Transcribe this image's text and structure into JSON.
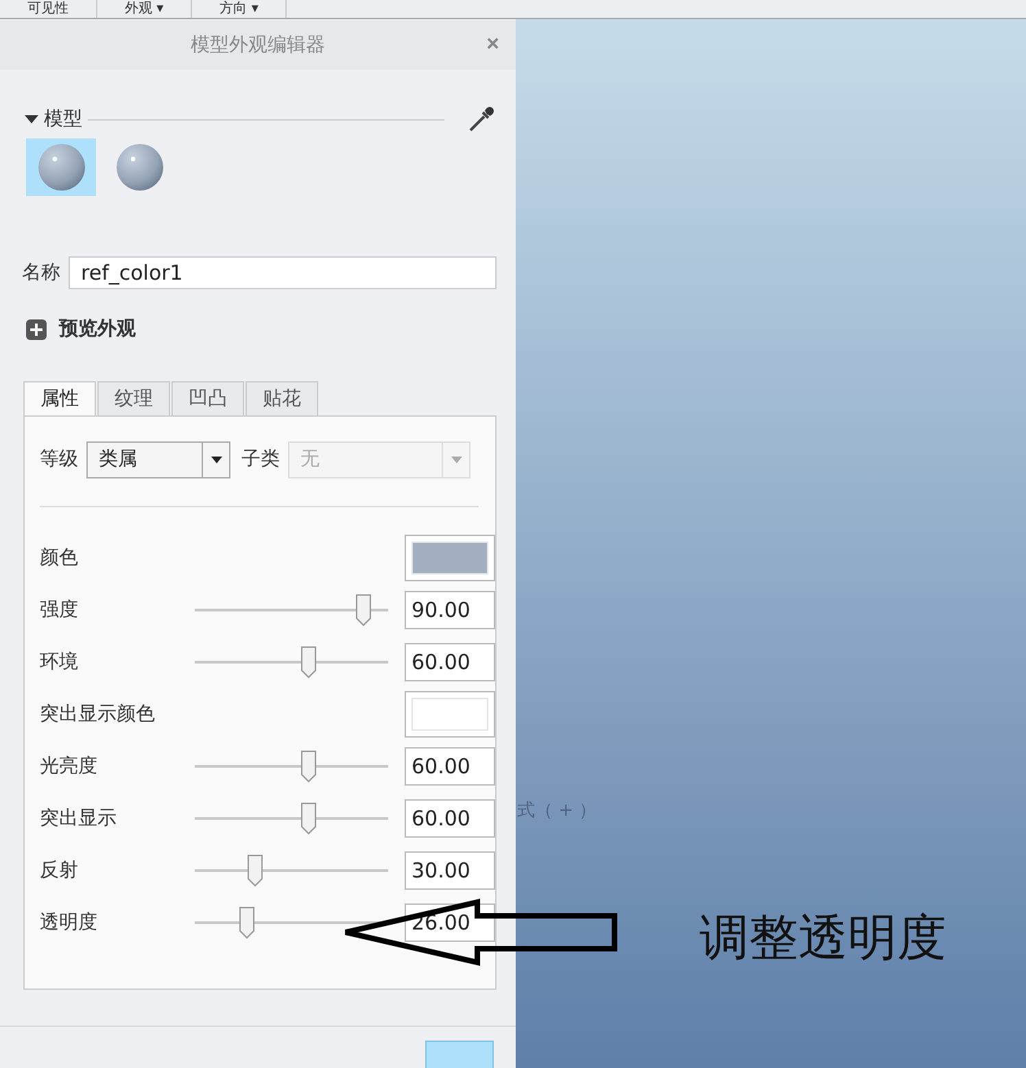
{
  "toolbar": [
    {
      "label": "可见性"
    },
    {
      "label": "外观 ▾"
    },
    {
      "label": "方向 ▾"
    }
  ],
  "dialog": {
    "title": "模型外观编辑器",
    "close": "×",
    "model_section": {
      "label": "模型",
      "expanded": true
    },
    "swatches": [
      {
        "selected": true
      },
      {
        "selected": false
      }
    ],
    "name_field": {
      "label": "名称",
      "value": "ref_color1"
    },
    "preview": {
      "label": "预览外观",
      "expanded": false
    },
    "tabs": [
      {
        "label": "属性",
        "selected": true
      },
      {
        "label": "纹理",
        "selected": false
      },
      {
        "label": "凹凸",
        "selected": false
      },
      {
        "label": "贴花",
        "selected": false
      }
    ],
    "grade": {
      "label": "等级",
      "value": "类属",
      "disabled": false
    },
    "subclass": {
      "label": "子类",
      "value": "无",
      "disabled": true
    },
    "properties": [
      {
        "kind": "color",
        "label": "颜色",
        "color": "#a3afc0"
      },
      {
        "kind": "slider",
        "label": "强度",
        "level": 0.87,
        "reading": "90.00"
      },
      {
        "kind": "slider",
        "label": "环境",
        "level": 0.59,
        "reading": "60.00"
      },
      {
        "kind": "color",
        "label": "突出显示颜色",
        "color": "#ffffff"
      },
      {
        "kind": "slider",
        "label": "光亮度",
        "level": 0.59,
        "reading": "60.00"
      },
      {
        "kind": "slider",
        "label": "突出显示",
        "level": 0.59,
        "reading": "60.00"
      },
      {
        "kind": "slider",
        "label": "反射",
        "level": 0.31,
        "reading": "30.00"
      },
      {
        "kind": "slider",
        "label": "透明度",
        "level": 0.27,
        "reading": "26.00"
      }
    ]
  },
  "viewport": {
    "hint": "式（ + ）"
  },
  "annotation": {
    "text": "调整透明度"
  }
}
